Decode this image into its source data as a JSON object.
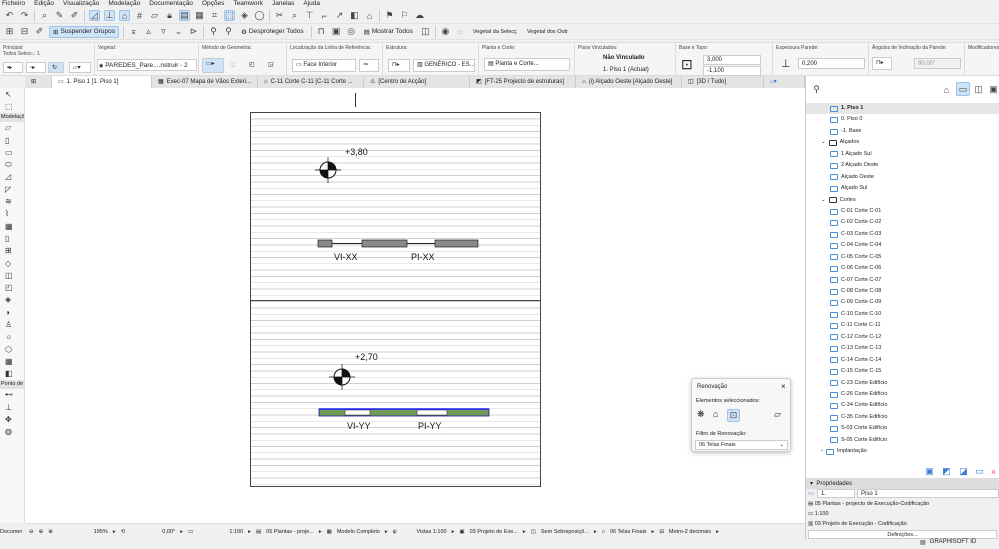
{
  "menu": [
    "Ficheiro",
    "Edição",
    "Visualização",
    "Modelação",
    "Documentação",
    "Opções",
    "Teamwork",
    "Janelas",
    "Ajuda"
  ],
  "toolbar2": {
    "suspend_groups": "Suspender Grupos",
    "unprotect_all": "Desproteger Todos",
    "show_all": "Mostrar Todos",
    "veg_sel": "Vegetal da Selecç",
    "veg_other": "Vegetal dos Outr"
  },
  "infobox": {
    "principal_label": "Principal:",
    "selected_count": "Todos Selecc.: 1",
    "layer_label": "Vegetal:",
    "layer_value": "PAREDES_Pare....nstruir - 2",
    "geometry_label": "Método de Geometria:",
    "refline_label": "Localização da Linha de Referência:",
    "refline_value": "Face Interior",
    "structure_label": "Estrutura:",
    "structure_value": "GENÉRICO - ES...",
    "floorplan_label": "Planta e Corte:",
    "floorplan_value": "Planta e Corte...",
    "linked_label": "Pisos Vinculados:",
    "linked_top": "Não Vinculado",
    "linked_bottom": "1. Piso 1 (Actual)",
    "base_label": "Base e Topo:",
    "top_value": "3,000",
    "base_value": "-1,100",
    "thickness_label": "Espessura Parede:",
    "thickness_value": "0,200",
    "angle_label": "Ângulos de Inclinação da Parede:",
    "angle_value": "90,00°",
    "modifiers_label": "Modificadores:"
  },
  "tabs": [
    "1. Piso 1 [1. Piso 1]",
    "Exec-07 Mapa de Vãos Exteri...",
    "C-11 Corte C-11 [C-11 Corte ...",
    "[Centro de Acção]",
    "[FT-25 Projecto de estruturas]",
    "(i) Alçado Oeste [Alçado Oeste]",
    "[3D / Tudo]"
  ],
  "toolbox": {
    "section_design": "Modelação",
    "section_doc": "Ponto de"
  },
  "drawing": {
    "level_top": "+3,80",
    "level_bottom": "+2,70",
    "label_vi_xx": "VI-XX",
    "label_pi_xx": "PI-XX",
    "label_vi_yy": "VI-YY",
    "label_pi_yy": "PI-YY"
  },
  "navigator": {
    "items": [
      {
        "label": "1. Piso 1",
        "indent": 2,
        "selected": true
      },
      {
        "label": "0. Piso 0",
        "indent": 2
      },
      {
        "label": "-1. Base",
        "indent": 2
      },
      {
        "label": "Alçados",
        "indent": 1,
        "group": true
      },
      {
        "label": "1 Alçado Sul",
        "indent": 2
      },
      {
        "label": "2 Alçado Oeste",
        "indent": 2
      },
      {
        "label": "Alçado Oeste",
        "indent": 2
      },
      {
        "label": "Alçado Sul",
        "indent": 2
      },
      {
        "label": "Cortes",
        "indent": 1,
        "group": true
      },
      {
        "label": "C-01 Corte C-01",
        "indent": 2
      },
      {
        "label": "C-02 Corte C-02",
        "indent": 2
      },
      {
        "label": "C-03 Corte C-03",
        "indent": 2
      },
      {
        "label": "C-04 Corte C-04",
        "indent": 2
      },
      {
        "label": "C-05 Corte C-05",
        "indent": 2
      },
      {
        "label": "C-06 Corte C-06",
        "indent": 2
      },
      {
        "label": "C-07 Corte C-07",
        "indent": 2
      },
      {
        "label": "C-08 Corte C-08",
        "indent": 2
      },
      {
        "label": "C-09 Corte C-09",
        "indent": 2
      },
      {
        "label": "C-10 Corte C-10",
        "indent": 2
      },
      {
        "label": "C-11 Corte C-11",
        "indent": 2
      },
      {
        "label": "C-12 Corte C-12",
        "indent": 2
      },
      {
        "label": "C-13 Corte C-13",
        "indent": 2
      },
      {
        "label": "C-14 Corte C-14",
        "indent": 2
      },
      {
        "label": "C-15 Corte C-15",
        "indent": 2
      },
      {
        "label": "C-23 Corte Edifício",
        "indent": 2
      },
      {
        "label": "C-26 Corte Edifício",
        "indent": 2
      },
      {
        "label": "C-34 Corte Edifício",
        "indent": 2
      },
      {
        "label": "C-35 Corte Edifício",
        "indent": 2
      },
      {
        "label": "S-03 Corte Edifício",
        "indent": 2
      },
      {
        "label": "S-05 Corte Edifício",
        "indent": 2
      },
      {
        "label": "Implantação",
        "indent": 1,
        "group": true,
        "collapsed": true
      }
    ]
  },
  "properties": {
    "title": "Propriedades",
    "id": "1.",
    "name": "Piso 1",
    "view_set": "05 Plantas - projecto de Execução-Codificação",
    "scale": "1:100",
    "phase": "03 Projeto de Execução - Codificação",
    "settings_button": "Definições..."
  },
  "renovation": {
    "title": "Renovação",
    "selected_label": "Elementos seleccionados:",
    "filter_label": "Filtro de Renovação:",
    "filter_value": "06 Telas Finais"
  },
  "status": {
    "doc": "Documer",
    "zoom": "195%",
    "angle": "0,00°",
    "scale": "1:100",
    "layer_combo": "05 Plantas - proje...",
    "model": "Modelo Completo",
    "views": "Vistas 1:100",
    "phase": "03 Projeto de Exe...",
    "override": "Sem Sobreposiçõ...",
    "renov": "06 Telas Finais",
    "units": "Metro-2 decimais"
  },
  "footer": {
    "graphisoft": "GRAPHISOFT ID"
  }
}
